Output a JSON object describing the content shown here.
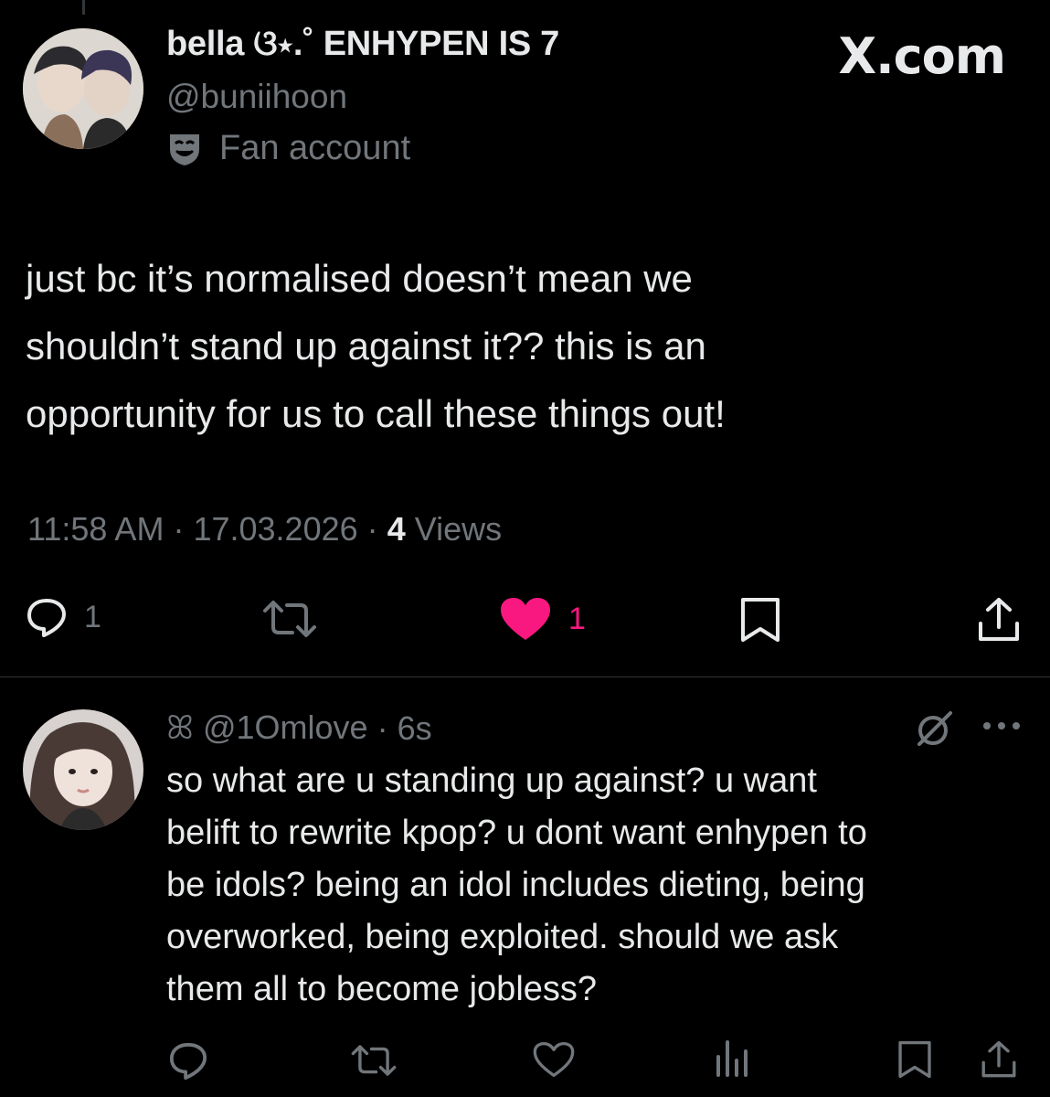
{
  "site_logo": "X.com",
  "tweet": {
    "author": {
      "display_name": "bella ଓ⋆.˚ ENHYPEN IS 7",
      "handle": "@buniihoon",
      "label": "Fan account",
      "label_icon": "mask-icon"
    },
    "text_lines": [
      "just bc it’s normalised doesn’t mean we",
      "shouldn’t stand up against it?? this is an",
      "opportunity for us to call these things out!"
    ],
    "time": "11:58 AM",
    "sep1": "·",
    "date": "17.03.2026",
    "sep2": "·",
    "views_count": "4",
    "views_label": "Views",
    "replies": "1",
    "likes": "1",
    "liked": true,
    "colors": {
      "like": "#f91880",
      "muted": "#71767b",
      "text": "#e7e9ea"
    }
  },
  "reply": {
    "handle": "ꕤ @1Omlove",
    "separator": "·",
    "time": "6s",
    "text_lines": [
      "so what are u standing up against? u want",
      "belift to rewrite kpop? u dont want enhypen to",
      "be idols? being an idol includes dieting, being",
      "overworked, being exploited. should we ask",
      "them all to become jobless?"
    ]
  }
}
